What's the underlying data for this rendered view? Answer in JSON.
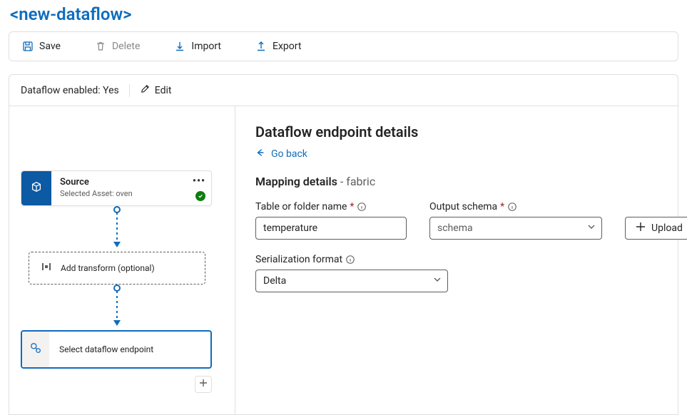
{
  "title": "<new-dataflow>",
  "toolbar": {
    "save": "Save",
    "delete": "Delete",
    "import": "Import",
    "export": "Export"
  },
  "status": {
    "label": "Dataflow enabled: Yes",
    "edit": "Edit"
  },
  "canvas": {
    "source": {
      "title": "Source",
      "subtitle": "Selected Asset: oven"
    },
    "transform": "Add transform (optional)",
    "destination": "Select dataflow endpoint"
  },
  "details": {
    "title": "Dataflow endpoint details",
    "goback": "Go back",
    "section_bold": "Mapping details",
    "section_sub": " - fabric",
    "table_label": "Table or folder name",
    "table_value": "temperature",
    "schema_label": "Output schema",
    "schema_placeholder": "schema",
    "upload": "Upload",
    "format_label": "Serialization format",
    "format_value": "Delta"
  }
}
